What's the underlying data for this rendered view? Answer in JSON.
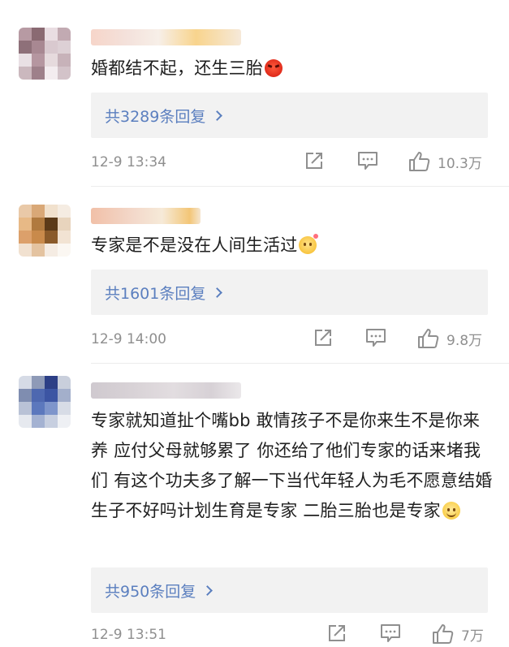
{
  "comments": [
    {
      "text": "婚都结不起，还生三胎",
      "emoji": "angry-face-emoji",
      "reply_label": "共3289条回复",
      "time": "12-9 13:34",
      "likes": "10.3万",
      "avatar_colors": [
        "#b79aa3",
        "#8a6a72",
        "#e9dde2",
        "#c2aab2",
        "#8e7079",
        "#a88892",
        "#d9c9cf",
        "#ddd0d5",
        "#e9e0e4",
        "#b596a0",
        "#e6dadd",
        "#c7b2b9",
        "#cbb8be",
        "#9e808a",
        "#f3ecef",
        "#d3c3c9"
      ]
    },
    {
      "text": "专家是不是没在人间生活过",
      "emoji": "thinking-face-emoji",
      "reply_label": "共1601条回复",
      "time": "12-9 14:00",
      "likes": "9.8万",
      "avatar_colors": [
        "#e9c9a8",
        "#d9a877",
        "#f1e1cd",
        "#f5ece2",
        "#e7b986",
        "#b07a3f",
        "#5b3a18",
        "#e8d4bd",
        "#dca06b",
        "#c98a4b",
        "#8a5a2a",
        "#f2e3d3",
        "#f1e1d0",
        "#e4c3a0",
        "#f5ece3",
        "#fbf7f2"
      ]
    },
    {
      "text": "专家就知道扯个嘴bb 敢情孩子不是你来生不是你来养 应付父母就够累了 你还给了他们专家的话来堵我们 有这个功夫多了解一下当代年轻人为毛不愿意结婚生子不好吗计划生育是专家 二胎三胎也是专家",
      "emoji": "smiling-face-emoji",
      "reply_label": "共950条回复",
      "time": "12-9 13:51",
      "likes": "7万",
      "avatar_colors": [
        "#d6dbe6",
        "#8e9ab7",
        "#2c3f86",
        "#c9cfdc",
        "#7f8db0",
        "#4e68b0",
        "#3c55a3",
        "#a3afcb",
        "#b9c2d6",
        "#5c78bd",
        "#7e95cb",
        "#d7dce6",
        "#e6e9ef",
        "#a4b2d2",
        "#c7cfe0",
        "#eef0f4"
      ]
    }
  ],
  "colors": {
    "reply_link": "#5b7fbf",
    "meta_text": "#8f8f8f",
    "reply_bg": "#f2f2f2"
  }
}
